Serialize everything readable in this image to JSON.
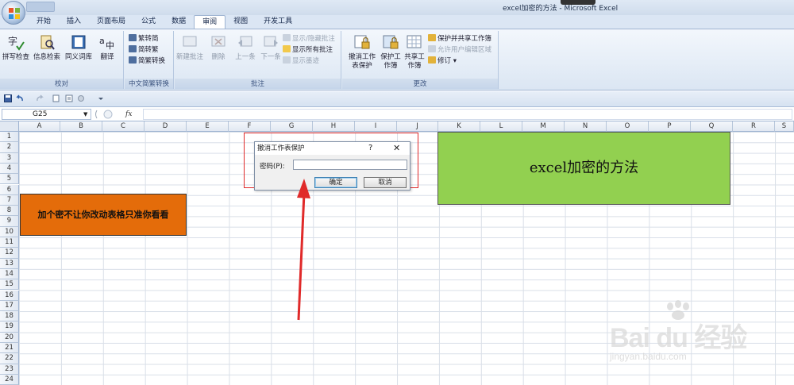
{
  "window": {
    "title": "excel加密的方法 - Microsoft Excel"
  },
  "ribbon": {
    "tabs": [
      "开始",
      "插入",
      "页面布局",
      "公式",
      "数据",
      "审阅",
      "视图",
      "开发工具"
    ],
    "active_tab": "审阅",
    "groups": {
      "proofing": {
        "label": "校对",
        "buttons": [
          "拼写检查",
          "信息检索",
          "同义词库",
          "翻译"
        ]
      },
      "chinese": {
        "label": "中文简繁转换",
        "buttons": [
          "繁转简",
          "简转繁",
          "简繁转换"
        ]
      },
      "comments": {
        "label": "批注",
        "buttons": [
          "新建批注",
          "删除",
          "上一条",
          "下一条"
        ],
        "small": [
          "显示/隐藏批注",
          "显示所有批注",
          "显示墨迹"
        ]
      },
      "changes": {
        "label": "更改",
        "buttons": [
          "撤消工作表保护",
          "保护工作簿",
          "共享工作簿"
        ],
        "small": [
          "保护并共享工作簿",
          "允许用户编辑区域",
          "修订"
        ]
      }
    }
  },
  "formula_bar": {
    "name_box": "G25",
    "fx": "fx",
    "value": ""
  },
  "grid": {
    "columns": [
      "A",
      "B",
      "C",
      "D",
      "E",
      "F",
      "G",
      "H",
      "I",
      "J",
      "K",
      "L",
      "M",
      "N",
      "O",
      "P",
      "Q",
      "R",
      "S"
    ],
    "rows": [
      "1",
      "2",
      "3",
      "4",
      "5",
      "6",
      "7",
      "8",
      "9",
      "10",
      "11",
      "12",
      "13",
      "14",
      "15",
      "16",
      "17",
      "18",
      "19",
      "20",
      "21",
      "22",
      "23",
      "24"
    ]
  },
  "shapes": {
    "orange_text": "加个密不让你改动表格只准你看看",
    "green_text": "excel加密的方法"
  },
  "dialog": {
    "title": "撤消工作表保护",
    "help": "?",
    "close": "✕",
    "password_label": "密码(P):",
    "password_value": "",
    "ok": "确定",
    "cancel": "取消"
  },
  "watermark": {
    "brand": "Bai du 经验",
    "url": "jingyan.baidu.com"
  },
  "colors": {
    "orange_fill": "#e46c0a",
    "green_fill": "#92d050",
    "arrow": "#e02a2a"
  }
}
